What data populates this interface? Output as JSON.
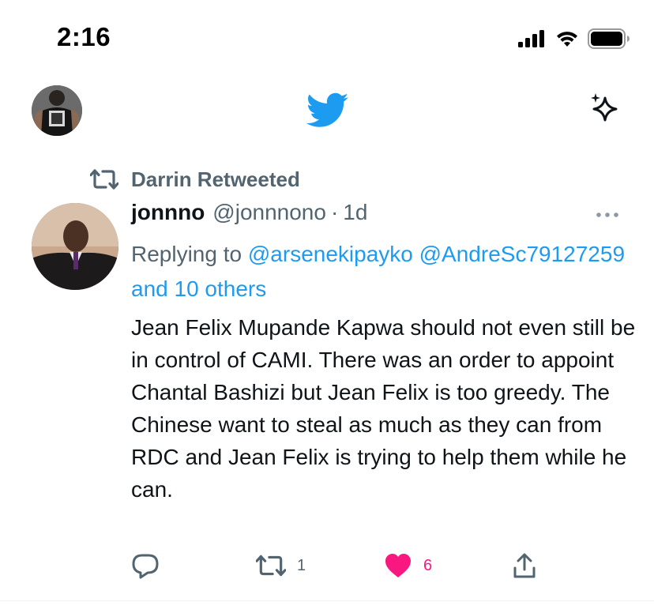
{
  "status_bar": {
    "time": "2:16",
    "icons": [
      "signal-icon",
      "wifi-icon",
      "battery-icon"
    ]
  },
  "header": {
    "profile_avatar": "avatar",
    "logo": "twitter-bird-icon",
    "sparkle": "sparkle-icon"
  },
  "retweet_context": {
    "label": "Darrin Retweeted"
  },
  "tweet": {
    "name": "jonnno",
    "handle": "@jonnnono",
    "separator": "·",
    "time": "1d",
    "replying_prefix": "Replying to",
    "replying_mentions": "@arsenekipayko @AndreSc79127259 and 10 others",
    "text": "Jean Felix Mupande Kapwa should not even still be in control of CAMI. There was an order to appoint Chantal Bashizi but Jean Felix is too greedy. The Chinese want to steal as much as they can from RDC and Jean Felix is trying to help them while he can.",
    "actions": {
      "reply_count": "",
      "retweet_count": "1",
      "like_count": "6"
    }
  },
  "colors": {
    "twitter_blue": "#1d9bf0",
    "gray_text": "#536471",
    "like_pink": "#f91880",
    "text": "#0f1419"
  }
}
